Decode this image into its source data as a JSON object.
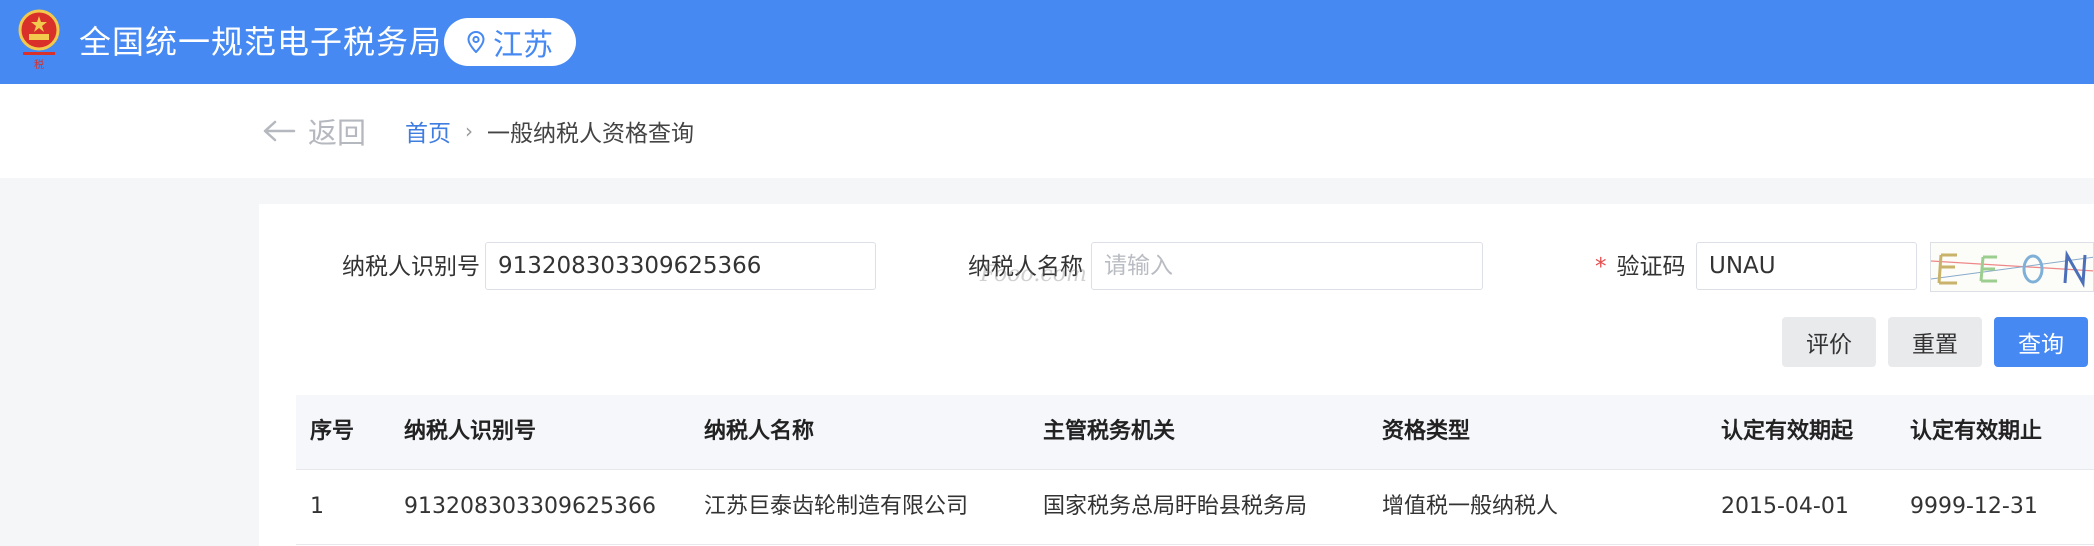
{
  "header": {
    "site_title": "全国统一规范电子税务局",
    "region": "江苏",
    "brand_color": "#4689f2"
  },
  "nav": {
    "back_label": "返回",
    "breadcrumb_home": "首页",
    "breadcrumb_separator": "›",
    "breadcrumb_current": "一般纳税人资格查询"
  },
  "form": {
    "taxpayer_id_label": "纳税人识别号",
    "taxpayer_id_value": "913208303309625366",
    "taxpayer_name_label": "纳税人名称",
    "taxpayer_name_placeholder": "请输入",
    "captcha_label": "验证码",
    "captcha_required_mark": "*",
    "captcha_value": "UNAU"
  },
  "buttons": {
    "evaluate": "评价",
    "reset": "重置",
    "query": "查询"
  },
  "table": {
    "columns": [
      "序号",
      "纳税人识别号",
      "纳税人名称",
      "主管税务机关",
      "资格类型",
      "认定有效期起",
      "认定有效期止"
    ],
    "rows": [
      [
        "1",
        "913208303309625366",
        "江苏巨泰齿轮制造有限公司",
        "国家税务总局盱眙县税务局",
        "增值税一般纳税人",
        "2015-04-01",
        "9999-12-31"
      ]
    ]
  },
  "watermark": "Fooo.com"
}
